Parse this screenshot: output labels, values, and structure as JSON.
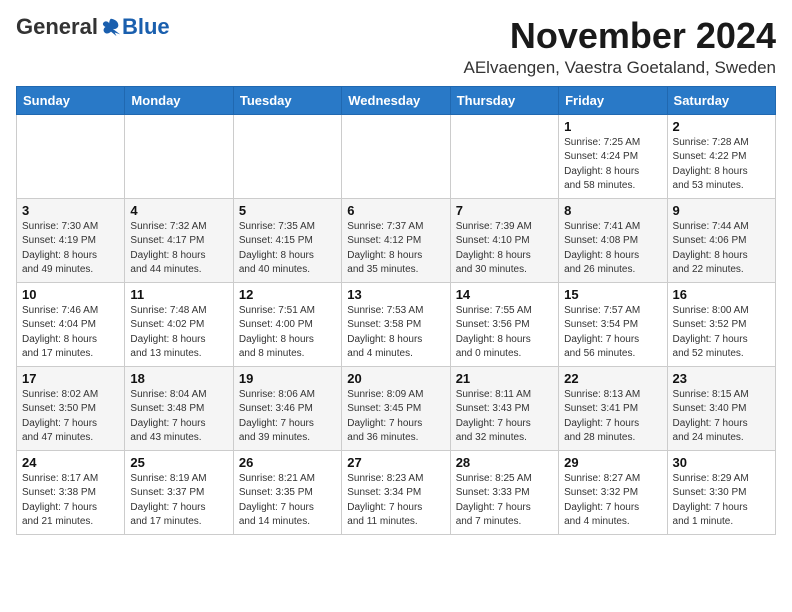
{
  "header": {
    "logo_general": "General",
    "logo_blue": "Blue",
    "month_title": "November 2024",
    "location": "AElvaengen, Vaestra Goetaland, Sweden"
  },
  "weekdays": [
    "Sunday",
    "Monday",
    "Tuesday",
    "Wednesday",
    "Thursday",
    "Friday",
    "Saturday"
  ],
  "weeks": [
    [
      {
        "day": "",
        "info": ""
      },
      {
        "day": "",
        "info": ""
      },
      {
        "day": "",
        "info": ""
      },
      {
        "day": "",
        "info": ""
      },
      {
        "day": "",
        "info": ""
      },
      {
        "day": "1",
        "info": "Sunrise: 7:25 AM\nSunset: 4:24 PM\nDaylight: 8 hours\nand 58 minutes."
      },
      {
        "day": "2",
        "info": "Sunrise: 7:28 AM\nSunset: 4:22 PM\nDaylight: 8 hours\nand 53 minutes."
      }
    ],
    [
      {
        "day": "3",
        "info": "Sunrise: 7:30 AM\nSunset: 4:19 PM\nDaylight: 8 hours\nand 49 minutes."
      },
      {
        "day": "4",
        "info": "Sunrise: 7:32 AM\nSunset: 4:17 PM\nDaylight: 8 hours\nand 44 minutes."
      },
      {
        "day": "5",
        "info": "Sunrise: 7:35 AM\nSunset: 4:15 PM\nDaylight: 8 hours\nand 40 minutes."
      },
      {
        "day": "6",
        "info": "Sunrise: 7:37 AM\nSunset: 4:12 PM\nDaylight: 8 hours\nand 35 minutes."
      },
      {
        "day": "7",
        "info": "Sunrise: 7:39 AM\nSunset: 4:10 PM\nDaylight: 8 hours\nand 30 minutes."
      },
      {
        "day": "8",
        "info": "Sunrise: 7:41 AM\nSunset: 4:08 PM\nDaylight: 8 hours\nand 26 minutes."
      },
      {
        "day": "9",
        "info": "Sunrise: 7:44 AM\nSunset: 4:06 PM\nDaylight: 8 hours\nand 22 minutes."
      }
    ],
    [
      {
        "day": "10",
        "info": "Sunrise: 7:46 AM\nSunset: 4:04 PM\nDaylight: 8 hours\nand 17 minutes."
      },
      {
        "day": "11",
        "info": "Sunrise: 7:48 AM\nSunset: 4:02 PM\nDaylight: 8 hours\nand 13 minutes."
      },
      {
        "day": "12",
        "info": "Sunrise: 7:51 AM\nSunset: 4:00 PM\nDaylight: 8 hours\nand 8 minutes."
      },
      {
        "day": "13",
        "info": "Sunrise: 7:53 AM\nSunset: 3:58 PM\nDaylight: 8 hours\nand 4 minutes."
      },
      {
        "day": "14",
        "info": "Sunrise: 7:55 AM\nSunset: 3:56 PM\nDaylight: 8 hours\nand 0 minutes."
      },
      {
        "day": "15",
        "info": "Sunrise: 7:57 AM\nSunset: 3:54 PM\nDaylight: 7 hours\nand 56 minutes."
      },
      {
        "day": "16",
        "info": "Sunrise: 8:00 AM\nSunset: 3:52 PM\nDaylight: 7 hours\nand 52 minutes."
      }
    ],
    [
      {
        "day": "17",
        "info": "Sunrise: 8:02 AM\nSunset: 3:50 PM\nDaylight: 7 hours\nand 47 minutes."
      },
      {
        "day": "18",
        "info": "Sunrise: 8:04 AM\nSunset: 3:48 PM\nDaylight: 7 hours\nand 43 minutes."
      },
      {
        "day": "19",
        "info": "Sunrise: 8:06 AM\nSunset: 3:46 PM\nDaylight: 7 hours\nand 39 minutes."
      },
      {
        "day": "20",
        "info": "Sunrise: 8:09 AM\nSunset: 3:45 PM\nDaylight: 7 hours\nand 36 minutes."
      },
      {
        "day": "21",
        "info": "Sunrise: 8:11 AM\nSunset: 3:43 PM\nDaylight: 7 hours\nand 32 minutes."
      },
      {
        "day": "22",
        "info": "Sunrise: 8:13 AM\nSunset: 3:41 PM\nDaylight: 7 hours\nand 28 minutes."
      },
      {
        "day": "23",
        "info": "Sunrise: 8:15 AM\nSunset: 3:40 PM\nDaylight: 7 hours\nand 24 minutes."
      }
    ],
    [
      {
        "day": "24",
        "info": "Sunrise: 8:17 AM\nSunset: 3:38 PM\nDaylight: 7 hours\nand 21 minutes."
      },
      {
        "day": "25",
        "info": "Sunrise: 8:19 AM\nSunset: 3:37 PM\nDaylight: 7 hours\nand 17 minutes."
      },
      {
        "day": "26",
        "info": "Sunrise: 8:21 AM\nSunset: 3:35 PM\nDaylight: 7 hours\nand 14 minutes."
      },
      {
        "day": "27",
        "info": "Sunrise: 8:23 AM\nSunset: 3:34 PM\nDaylight: 7 hours\nand 11 minutes."
      },
      {
        "day": "28",
        "info": "Sunrise: 8:25 AM\nSunset: 3:33 PM\nDaylight: 7 hours\nand 7 minutes."
      },
      {
        "day": "29",
        "info": "Sunrise: 8:27 AM\nSunset: 3:32 PM\nDaylight: 7 hours\nand 4 minutes."
      },
      {
        "day": "30",
        "info": "Sunrise: 8:29 AM\nSunset: 3:30 PM\nDaylight: 7 hours\nand 1 minute."
      }
    ]
  ]
}
